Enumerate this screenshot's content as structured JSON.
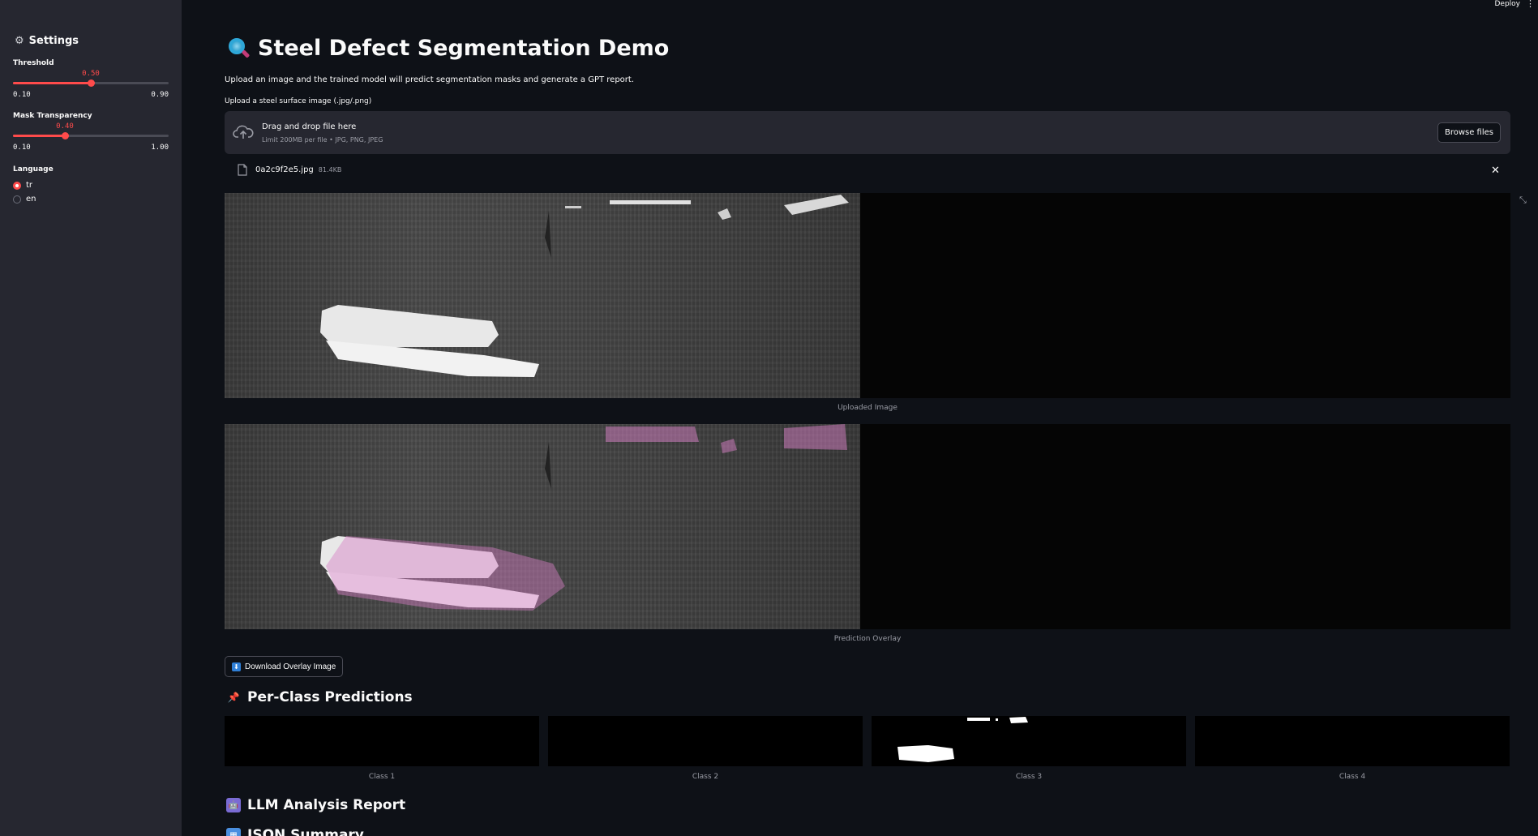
{
  "sidebar": {
    "title": "Settings",
    "threshold": {
      "label": "Threshold",
      "value": "0.50",
      "min": "0.10",
      "max": "0.90",
      "fraction": 0.5
    },
    "mask_transparency": {
      "label": "Mask Transparency",
      "value": "0.40",
      "min": "0.10",
      "max": "1.00",
      "fraction": 0.333
    },
    "language": {
      "label": "Language",
      "options": [
        "tr",
        "en"
      ],
      "selected": "tr"
    }
  },
  "header": {
    "deploy_label": "Deploy",
    "menu_icon": "kebab-icon"
  },
  "main": {
    "title": "Steel Defect Segmentation Demo",
    "subtitle": "Upload an image and the trained model will predict segmentation masks and generate a GPT report.",
    "uploader": {
      "label": "Upload a steel surface image (.jpg/.png)",
      "drop_text": "Drag and drop file here",
      "limit_text": "Limit 200MB per file • JPG, PNG, JPEG",
      "browse_label": "Browse files"
    },
    "file": {
      "name": "0a2c9f2e5.jpg",
      "size": "81.4KB"
    },
    "uploaded_caption": "Uploaded Image",
    "overlay_caption": "Prediction Overlay",
    "download_label": "Download Overlay Image",
    "per_class_title": "Per-Class Predictions",
    "class_captions": [
      "Class 1",
      "Class 2",
      "Class 3",
      "Class 4"
    ],
    "llm_title": "LLM Analysis Report",
    "json_title": "JSON Summary"
  },
  "colors": {
    "accent": "#ff4b4b",
    "bg": "#0e1117",
    "sidebar": "#262730",
    "mask": "#d77fc6"
  }
}
